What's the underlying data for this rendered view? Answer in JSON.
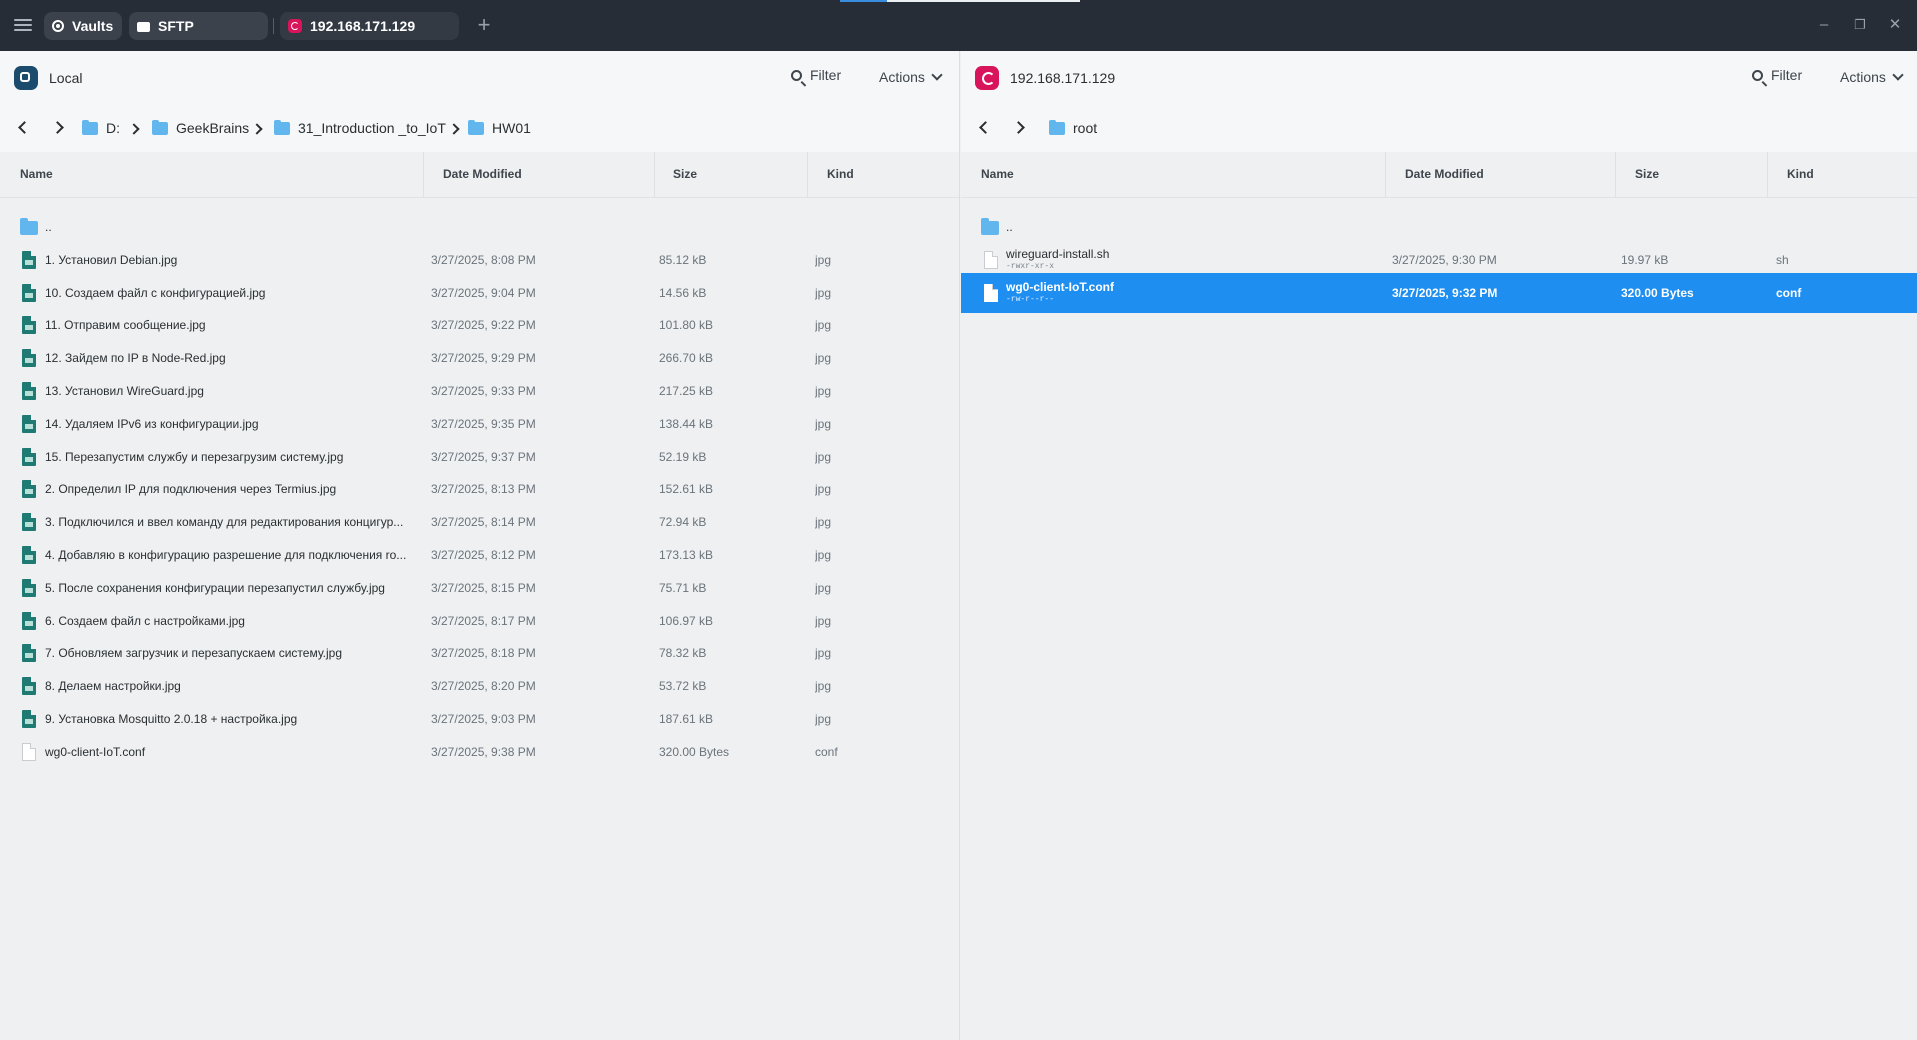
{
  "titlebar": {
    "tabs": [
      {
        "label": "Vaults",
        "icon": "vault-icon"
      },
      {
        "label": "SFTP",
        "icon": "folder-icon"
      },
      {
        "label": "192.168.171.129",
        "icon": "debian-icon"
      }
    ],
    "new_tab": "+",
    "window_controls": {
      "minimize": "–",
      "maximize": "❐",
      "close": "✕"
    }
  },
  "left": {
    "title": "Local",
    "filter_label": "Filter",
    "actions_label": "Actions",
    "breadcrumb": [
      "D:",
      "GeekBrains",
      "31_Introduction _to_IoT",
      "HW01"
    ],
    "columns": [
      "Name",
      "Date Modified",
      "Size",
      "Kind"
    ],
    "rows": [
      {
        "name": "..",
        "date": "",
        "size": "",
        "kind": "",
        "type": "folder"
      },
      {
        "name": "1. Установил Debian.jpg",
        "date": "3/27/2025, 8:08 PM",
        "size": "85.12 kB",
        "kind": "jpg",
        "type": "jpg"
      },
      {
        "name": "10. Создаем файл с конфигурацией.jpg",
        "date": "3/27/2025, 9:04 PM",
        "size": "14.56 kB",
        "kind": "jpg",
        "type": "jpg"
      },
      {
        "name": "11. Отправим сообщение.jpg",
        "date": "3/27/2025, 9:22 PM",
        "size": "101.80 kB",
        "kind": "jpg",
        "type": "jpg"
      },
      {
        "name": "12. Зайдем по IP в Node-Red.jpg",
        "date": "3/27/2025, 9:29 PM",
        "size": "266.70 kB",
        "kind": "jpg",
        "type": "jpg"
      },
      {
        "name": "13. Установил WireGuard.jpg",
        "date": "3/27/2025, 9:33 PM",
        "size": "217.25 kB",
        "kind": "jpg",
        "type": "jpg"
      },
      {
        "name": "14. Удаляем IPv6 из конфигурации.jpg",
        "date": "3/27/2025, 9:35 PM",
        "size": "138.44 kB",
        "kind": "jpg",
        "type": "jpg"
      },
      {
        "name": "15. Перезапустим службу и перезагрузим систему.jpg",
        "date": "3/27/2025, 9:37 PM",
        "size": "52.19 kB",
        "kind": "jpg",
        "type": "jpg"
      },
      {
        "name": "2. Определил IP для подключения через Termius.jpg",
        "date": "3/27/2025, 8:13 PM",
        "size": "152.61 kB",
        "kind": "jpg",
        "type": "jpg"
      },
      {
        "name": "3. Подключился и ввел команду для редактирования концигур...",
        "date": "3/27/2025, 8:14 PM",
        "size": "72.94 kB",
        "kind": "jpg",
        "type": "jpg"
      },
      {
        "name": "4. Добавляю в конфигурацию разрешение для подключения ro...",
        "date": "3/27/2025, 8:12 PM",
        "size": "173.13 kB",
        "kind": "jpg",
        "type": "jpg"
      },
      {
        "name": "5. После сохранения конфигурации перезапустил службу.jpg",
        "date": "3/27/2025, 8:15 PM",
        "size": "75.71 kB",
        "kind": "jpg",
        "type": "jpg"
      },
      {
        "name": "6. Создаем файл с настройками.jpg",
        "date": "3/27/2025, 8:17 PM",
        "size": "106.97 kB",
        "kind": "jpg",
        "type": "jpg"
      },
      {
        "name": "7. Обновляем загрузчик и перезапускаем систему.jpg",
        "date": "3/27/2025, 8:18 PM",
        "size": "78.32 kB",
        "kind": "jpg",
        "type": "jpg"
      },
      {
        "name": "8. Делаем настройки.jpg",
        "date": "3/27/2025, 8:20 PM",
        "size": "53.72 kB",
        "kind": "jpg",
        "type": "jpg"
      },
      {
        "name": "9. Установка Mosquitto 2.0.18 + настройка.jpg",
        "date": "3/27/2025, 9:03 PM",
        "size": "187.61 kB",
        "kind": "jpg",
        "type": "jpg"
      },
      {
        "name": "wg0-client-IoT.conf",
        "date": "3/27/2025, 9:38 PM",
        "size": "320.00 Bytes",
        "kind": "conf",
        "type": "doc"
      }
    ]
  },
  "right": {
    "title": "192.168.171.129",
    "filter_label": "Filter",
    "actions_label": "Actions",
    "breadcrumb": [
      "root"
    ],
    "columns": [
      "Name",
      "Date Modified",
      "Size",
      "Kind"
    ],
    "rows": [
      {
        "name": "..",
        "perm": "",
        "date": "",
        "size": "",
        "kind": "",
        "type": "folder"
      },
      {
        "name": "wireguard-install.sh",
        "perm": "-rwxr-xr-x",
        "date": "3/27/2025, 9:30 PM",
        "size": "19.97 kB",
        "kind": "sh",
        "type": "doc"
      },
      {
        "name": "wg0-client-IoT.conf",
        "perm": "-rw-r--r--",
        "date": "3/27/2025, 9:32 PM",
        "size": "320.00 Bytes",
        "kind": "conf",
        "type": "doc",
        "selected": true
      }
    ]
  },
  "colors": {
    "titlebar": "#272d36",
    "accent": "#1f8ef1",
    "folder": "#62b6ee",
    "jpg_icon": "#1f7a74",
    "debian": "#d8145b"
  }
}
